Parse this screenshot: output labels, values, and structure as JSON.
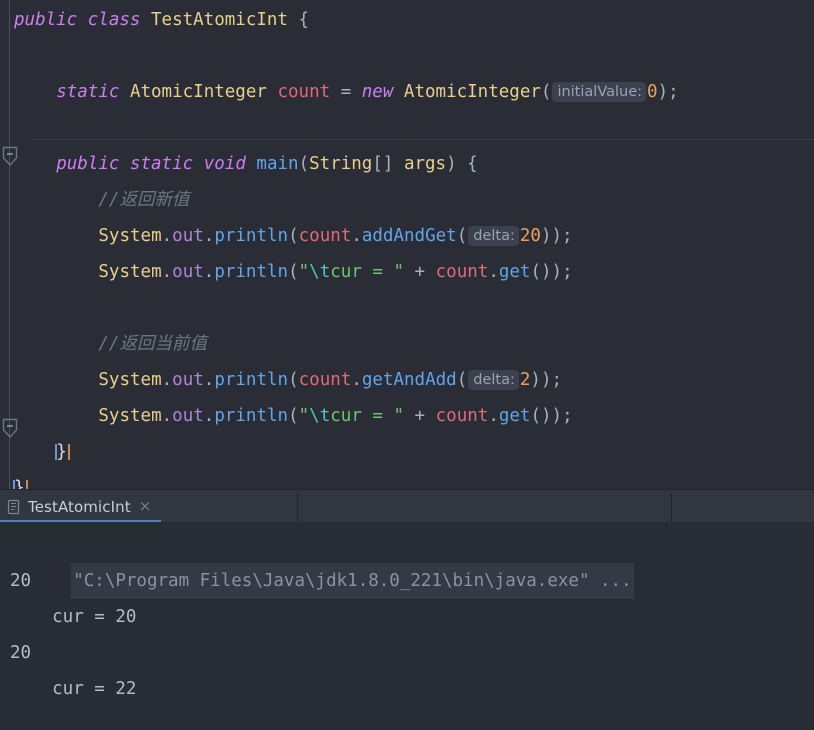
{
  "app": {
    "theme": "darcula",
    "colors": {
      "editor_bg": "#2b2d36",
      "console_bg": "#282c34",
      "tabbar_bg": "#323640",
      "accent": "#4c7fd4",
      "keyword": "#cc7ff0",
      "type": "#e8cf8b",
      "field": "#e06a77",
      "method": "#61a5e8",
      "string": "#6cc56c",
      "escape": "#3ecfb2",
      "number": "#e8a35c",
      "comment": "#70757f",
      "hint_bg": "#3b414e"
    }
  },
  "editor": {
    "class_name": "TestAtomicInt",
    "lines": [
      {
        "indent": 0,
        "tokens": [
          {
            "t": "public",
            "c": "kw"
          },
          {
            "t": " ",
            "c": "pun"
          },
          {
            "t": "class",
            "c": "kw"
          },
          {
            "t": " ",
            "c": "pun"
          },
          {
            "t": "TestAtomicInt",
            "c": "cls"
          },
          {
            "t": " {",
            "c": "pun"
          }
        ]
      },
      {
        "indent": 0,
        "tokens": []
      },
      {
        "indent": 4,
        "tokens": [
          {
            "t": "static",
            "c": "kw"
          },
          {
            "t": " ",
            "c": "pun"
          },
          {
            "t": "AtomicInteger",
            "c": "typ"
          },
          {
            "t": " ",
            "c": "pun"
          },
          {
            "t": "count",
            "c": "fld"
          },
          {
            "t": " = ",
            "c": "op"
          },
          {
            "t": "new",
            "c": "kw"
          },
          {
            "t": " ",
            "c": "pun"
          },
          {
            "t": "AtomicInteger",
            "c": "typ"
          },
          {
            "t": "(",
            "c": "pun"
          },
          {
            "t": "initialValue:",
            "c": "hint"
          },
          {
            "t": "0",
            "c": "num"
          },
          {
            "t": ");",
            "c": "pun"
          }
        ]
      },
      {
        "indent": 0,
        "tokens": []
      },
      {
        "indent": 4,
        "tokens": [
          {
            "t": "public",
            "c": "kw"
          },
          {
            "t": " ",
            "c": "pun"
          },
          {
            "t": "static",
            "c": "kw"
          },
          {
            "t": " ",
            "c": "pun"
          },
          {
            "t": "void",
            "c": "kw"
          },
          {
            "t": " ",
            "c": "pun"
          },
          {
            "t": "main",
            "c": "mth"
          },
          {
            "t": "(",
            "c": "pun"
          },
          {
            "t": "String",
            "c": "typ"
          },
          {
            "t": "[] ",
            "c": "pun"
          },
          {
            "t": "args",
            "c": "typ"
          },
          {
            "t": ") {",
            "c": "pun"
          }
        ]
      },
      {
        "indent": 8,
        "tokens": [
          {
            "t": "//返回新值",
            "c": "cmt"
          }
        ]
      },
      {
        "indent": 8,
        "tokens": [
          {
            "t": "System",
            "c": "typ"
          },
          {
            "t": ".",
            "c": "pun"
          },
          {
            "t": "out",
            "c": "pkg"
          },
          {
            "t": ".",
            "c": "pun"
          },
          {
            "t": "println",
            "c": "mth"
          },
          {
            "t": "(",
            "c": "pun"
          },
          {
            "t": "count",
            "c": "fld"
          },
          {
            "t": ".",
            "c": "pun"
          },
          {
            "t": "addAndGet",
            "c": "mth"
          },
          {
            "t": "(",
            "c": "pun"
          },
          {
            "t": "delta:",
            "c": "hint"
          },
          {
            "t": "20",
            "c": "num"
          },
          {
            "t": "));",
            "c": "pun"
          }
        ]
      },
      {
        "indent": 8,
        "tokens": [
          {
            "t": "System",
            "c": "typ"
          },
          {
            "t": ".",
            "c": "pun"
          },
          {
            "t": "out",
            "c": "pkg"
          },
          {
            "t": ".",
            "c": "pun"
          },
          {
            "t": "println",
            "c": "mth"
          },
          {
            "t": "(",
            "c": "pun"
          },
          {
            "t": "\"",
            "c": "str"
          },
          {
            "t": "\\t",
            "c": "esc"
          },
          {
            "t": "cur = \"",
            "c": "str"
          },
          {
            "t": " + ",
            "c": "op"
          },
          {
            "t": "count",
            "c": "fld"
          },
          {
            "t": ".",
            "c": "pun"
          },
          {
            "t": "get",
            "c": "mth"
          },
          {
            "t": "());",
            "c": "pun"
          }
        ]
      },
      {
        "indent": 0,
        "tokens": []
      },
      {
        "indent": 8,
        "tokens": [
          {
            "t": "//返回当前值",
            "c": "cmt"
          }
        ]
      },
      {
        "indent": 8,
        "tokens": [
          {
            "t": "System",
            "c": "typ"
          },
          {
            "t": ".",
            "c": "pun"
          },
          {
            "t": "out",
            "c": "pkg"
          },
          {
            "t": ".",
            "c": "pun"
          },
          {
            "t": "println",
            "c": "mth"
          },
          {
            "t": "(",
            "c": "pun"
          },
          {
            "t": "count",
            "c": "fld"
          },
          {
            "t": ".",
            "c": "pun"
          },
          {
            "t": "getAndAdd",
            "c": "mth"
          },
          {
            "t": "(",
            "c": "pun"
          },
          {
            "t": "delta:",
            "c": "hint"
          },
          {
            "t": "2",
            "c": "num"
          },
          {
            "t": "));",
            "c": "pun"
          }
        ]
      },
      {
        "indent": 8,
        "tokens": [
          {
            "t": "System",
            "c": "typ"
          },
          {
            "t": ".",
            "c": "pun"
          },
          {
            "t": "out",
            "c": "pkg"
          },
          {
            "t": ".",
            "c": "pun"
          },
          {
            "t": "println",
            "c": "mth"
          },
          {
            "t": "(",
            "c": "pun"
          },
          {
            "t": "\"",
            "c": "str"
          },
          {
            "t": "\\t",
            "c": "esc"
          },
          {
            "t": "cur = \"",
            "c": "str"
          },
          {
            "t": " + ",
            "c": "op"
          },
          {
            "t": "count",
            "c": "fld"
          },
          {
            "t": ".",
            "c": "pun"
          },
          {
            "t": "get",
            "c": "mth"
          },
          {
            "t": "());",
            "c": "pun"
          }
        ]
      },
      {
        "indent": 4,
        "tokens": [
          {
            "t": "}",
            "c": "brace-hl"
          }
        ]
      },
      {
        "indent": 0,
        "tokens": [
          {
            "t": "}",
            "c": "brace-hl"
          }
        ]
      }
    ]
  },
  "run_tab": {
    "icon": "run-configuration-icon",
    "label": "TestAtomicInt",
    "close": "×"
  },
  "console": {
    "command": "\"C:\\Program Files\\Java\\jdk1.8.0_221\\bin\\java.exe\" ...",
    "output": [
      "20",
      "    cur = 20",
      "20",
      "    cur = 22"
    ]
  }
}
